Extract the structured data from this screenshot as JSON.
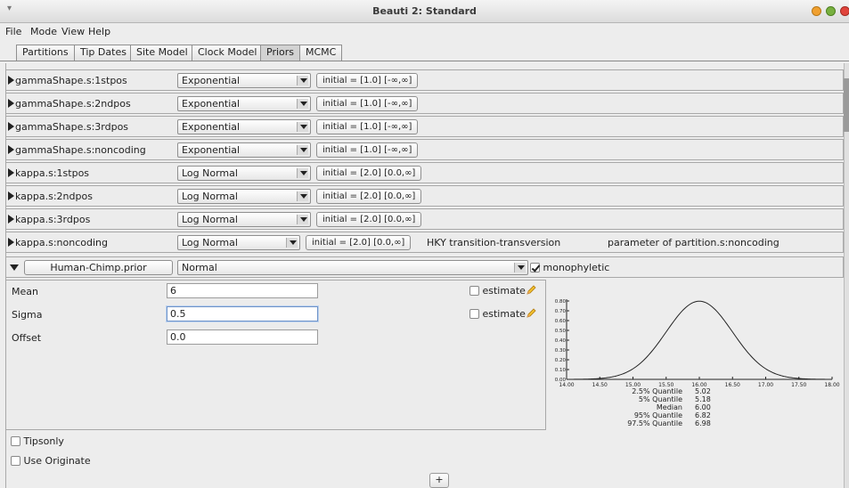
{
  "window": {
    "title": "Beauti 2: Standard",
    "menu_glyph": "▾"
  },
  "menu": {
    "file": "File",
    "mode": "Mode",
    "view": "View",
    "help": "Help"
  },
  "tabs": [
    "Partitions",
    "Tip Dates",
    "Site Model",
    "Clock Model",
    "Priors",
    "MCMC"
  ],
  "active_tab": "Priors",
  "priors": [
    {
      "name": "gammaShape.s:1stpos",
      "dist": "Exponential",
      "initial": "initial = [1.0] [-∞,∞]"
    },
    {
      "name": "gammaShape.s:2ndpos",
      "dist": "Exponential",
      "initial": "initial = [1.0] [-∞,∞]"
    },
    {
      "name": "gammaShape.s:3rdpos",
      "dist": "Exponential",
      "initial": "initial = [1.0] [-∞,∞]"
    },
    {
      "name": "gammaShape.s:noncoding",
      "dist": "Exponential",
      "initial": "initial = [1.0] [-∞,∞]"
    },
    {
      "name": "kappa.s:1stpos",
      "dist": "Log Normal",
      "initial": "initial = [2.0] [0.0,∞]"
    },
    {
      "name": "kappa.s:2ndpos",
      "dist": "Log Normal",
      "initial": "initial = [2.0] [0.0,∞]"
    },
    {
      "name": "kappa.s:3rdpos",
      "dist": "Log Normal",
      "initial": "initial = [2.0] [0.0,∞]"
    },
    {
      "name": "kappa.s:noncoding",
      "dist": "Log Normal",
      "initial": "initial = [2.0] [0.0,∞]",
      "desc1": "HKY transition-transversion",
      "desc2": "parameter of partition.s:noncoding"
    }
  ],
  "expanded": {
    "name": "Human-Chimp.prior",
    "dist": "Normal",
    "monophyletic_label": "monophyletic",
    "monophyletic_checked": true,
    "params": [
      {
        "label": "Mean",
        "value": "6",
        "estimate": "estimate"
      },
      {
        "label": "Sigma",
        "value": "0.5",
        "estimate": "estimate"
      },
      {
        "label": "Offset",
        "value": "0.0"
      }
    ]
  },
  "chart_data": {
    "type": "line",
    "y_ticks": [
      "0.80",
      "0.70",
      "0.60",
      "0.50",
      "0.40",
      "0.30",
      "0.20",
      "0.10",
      "0.00"
    ],
    "x_ticks": [
      "14.00",
      "14.50",
      "15.00",
      "15.50",
      "16.00",
      "16.50",
      "17.00",
      "17.50",
      "18.00"
    ],
    "xlim": [
      14.0,
      18.0
    ],
    "ylim": [
      0.0,
      0.8
    ],
    "curve": {
      "mean": 16.0,
      "sigma": 0.5
    },
    "quantiles": [
      {
        "label": "2.5% Quantile",
        "value": "5.02"
      },
      {
        "label": "5% Quantile",
        "value": "5.18"
      },
      {
        "label": "Median",
        "value": "6.00"
      },
      {
        "label": "95% Quantile",
        "value": "6.82"
      },
      {
        "label": "97.5% Quantile",
        "value": "6.98"
      }
    ]
  },
  "options": {
    "tipsonly": "Tipsonly",
    "use_originate": "Use Originate"
  },
  "add_button": "+",
  "colors": {
    "btn_red": "#e0443c",
    "btn_orange": "#f0a030",
    "btn_green": "#78b040"
  }
}
